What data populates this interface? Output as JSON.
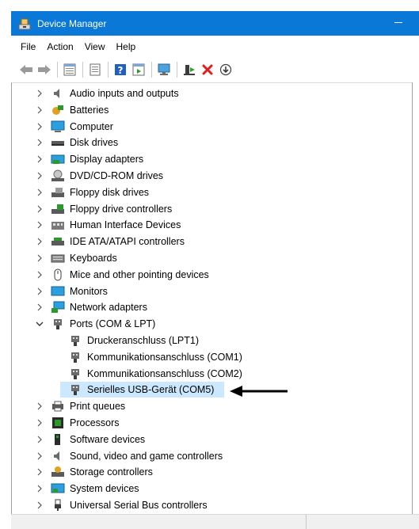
{
  "window": {
    "title": "Device Manager",
    "icon": "device-manager-icon"
  },
  "menu": [
    {
      "label": "File"
    },
    {
      "label": "Action"
    },
    {
      "label": "View"
    },
    {
      "label": "Help"
    }
  ],
  "toolbar": [
    {
      "icon": "back-icon"
    },
    {
      "icon": "forward-icon"
    },
    {
      "icon": "properties-list-icon"
    },
    {
      "icon": "show-hide-icon"
    },
    {
      "icon": "help-icon"
    },
    {
      "icon": "update-view-icon"
    },
    {
      "icon": "scan-hardware-icon"
    },
    {
      "icon": "enable-device-icon"
    },
    {
      "icon": "uninstall-icon"
    },
    {
      "icon": "update-driver-icon"
    }
  ],
  "tree": {
    "categories": [
      {
        "label": "Audio inputs and outputs",
        "icon": "speaker-icon",
        "expanded": false
      },
      {
        "label": "Batteries",
        "icon": "battery-icon",
        "expanded": false
      },
      {
        "label": "Computer",
        "icon": "computer-icon",
        "expanded": false
      },
      {
        "label": "Disk drives",
        "icon": "disk-drive-icon",
        "expanded": false
      },
      {
        "label": "Display adapters",
        "icon": "display-adapter-icon",
        "expanded": false
      },
      {
        "label": "DVD/CD-ROM drives",
        "icon": "dvd-drive-icon",
        "expanded": false
      },
      {
        "label": "Floppy disk drives",
        "icon": "floppy-disk-icon",
        "expanded": false
      },
      {
        "label": "Floppy drive controllers",
        "icon": "floppy-controller-icon",
        "expanded": false
      },
      {
        "label": "Human Interface Devices",
        "icon": "hid-icon",
        "expanded": false
      },
      {
        "label": "IDE ATA/ATAPI controllers",
        "icon": "ide-controller-icon",
        "expanded": false
      },
      {
        "label": "Keyboards",
        "icon": "keyboard-icon",
        "expanded": false
      },
      {
        "label": "Mice and other pointing devices",
        "icon": "mouse-icon",
        "expanded": false
      },
      {
        "label": "Monitors",
        "icon": "monitor-icon",
        "expanded": false
      },
      {
        "label": "Network adapters",
        "icon": "network-adapter-icon",
        "expanded": false
      },
      {
        "label": "Ports (COM & LPT)",
        "icon": "port-icon",
        "expanded": true,
        "children": [
          {
            "label": "Druckeranschluss (LPT1)",
            "icon": "port-icon",
            "selected": false
          },
          {
            "label": "Kommunikationsanschluss (COM1)",
            "icon": "port-icon",
            "selected": false
          },
          {
            "label": "Kommunikationsanschluss (COM2)",
            "icon": "port-icon",
            "selected": false
          },
          {
            "label": "Serielles USB-Gerät (COM5)",
            "icon": "port-icon",
            "selected": true
          }
        ]
      },
      {
        "label": "Print queues",
        "icon": "printer-icon",
        "expanded": false
      },
      {
        "label": "Processors",
        "icon": "processor-icon",
        "expanded": false
      },
      {
        "label": "Software devices",
        "icon": "software-device-icon",
        "expanded": false
      },
      {
        "label": "Sound, video and game controllers",
        "icon": "speaker-icon",
        "expanded": false
      },
      {
        "label": "Storage controllers",
        "icon": "storage-controller-icon",
        "expanded": false
      },
      {
        "label": "System devices",
        "icon": "system-device-icon",
        "expanded": false
      },
      {
        "label": "Universal Serial Bus controllers",
        "icon": "usb-icon",
        "expanded": false
      }
    ]
  },
  "colors": {
    "titlebar": "#0a78d7",
    "selection": "#cce8ff"
  }
}
